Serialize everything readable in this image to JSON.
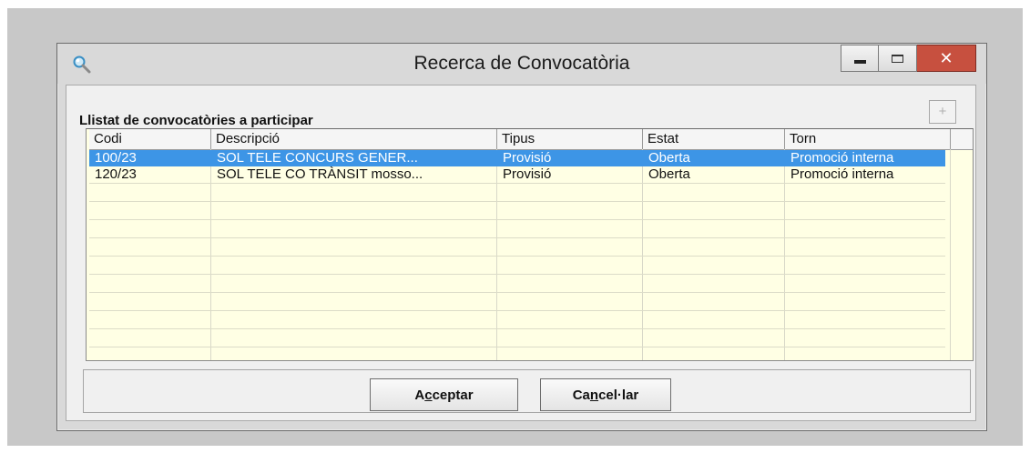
{
  "window": {
    "title": "Recerca de Convocatòria",
    "close_glyph": "✕",
    "add_glyph": "+",
    "search_icon": "search-icon"
  },
  "list": {
    "label": "Llistat de convocatòries a participar",
    "columns": [
      "Codi",
      "Descripció",
      "Tipus",
      "Estat",
      "Torn"
    ],
    "rows": [
      {
        "codi": "100/23",
        "descripcio": "SOL TELE CONCURS GENER...",
        "tipus": "Provisió",
        "estat": "Oberta",
        "torn": "Promoció interna",
        "selected": true
      },
      {
        "codi": "120/23",
        "descripcio": "SOL TELE CO TRÀNSIT mosso...",
        "tipus": "Provisió",
        "estat": "Oberta",
        "torn": "Promoció interna",
        "selected": false
      }
    ]
  },
  "buttons": {
    "accept_pre": "A",
    "accept_key": "c",
    "accept_post": "ceptar",
    "cancel_pre": "Ca",
    "cancel_key": "n",
    "cancel_post": "cel·lar"
  },
  "colors": {
    "selection": "#3d95e6",
    "grid_background": "#ffffe4",
    "close_button": "#c7503f"
  }
}
